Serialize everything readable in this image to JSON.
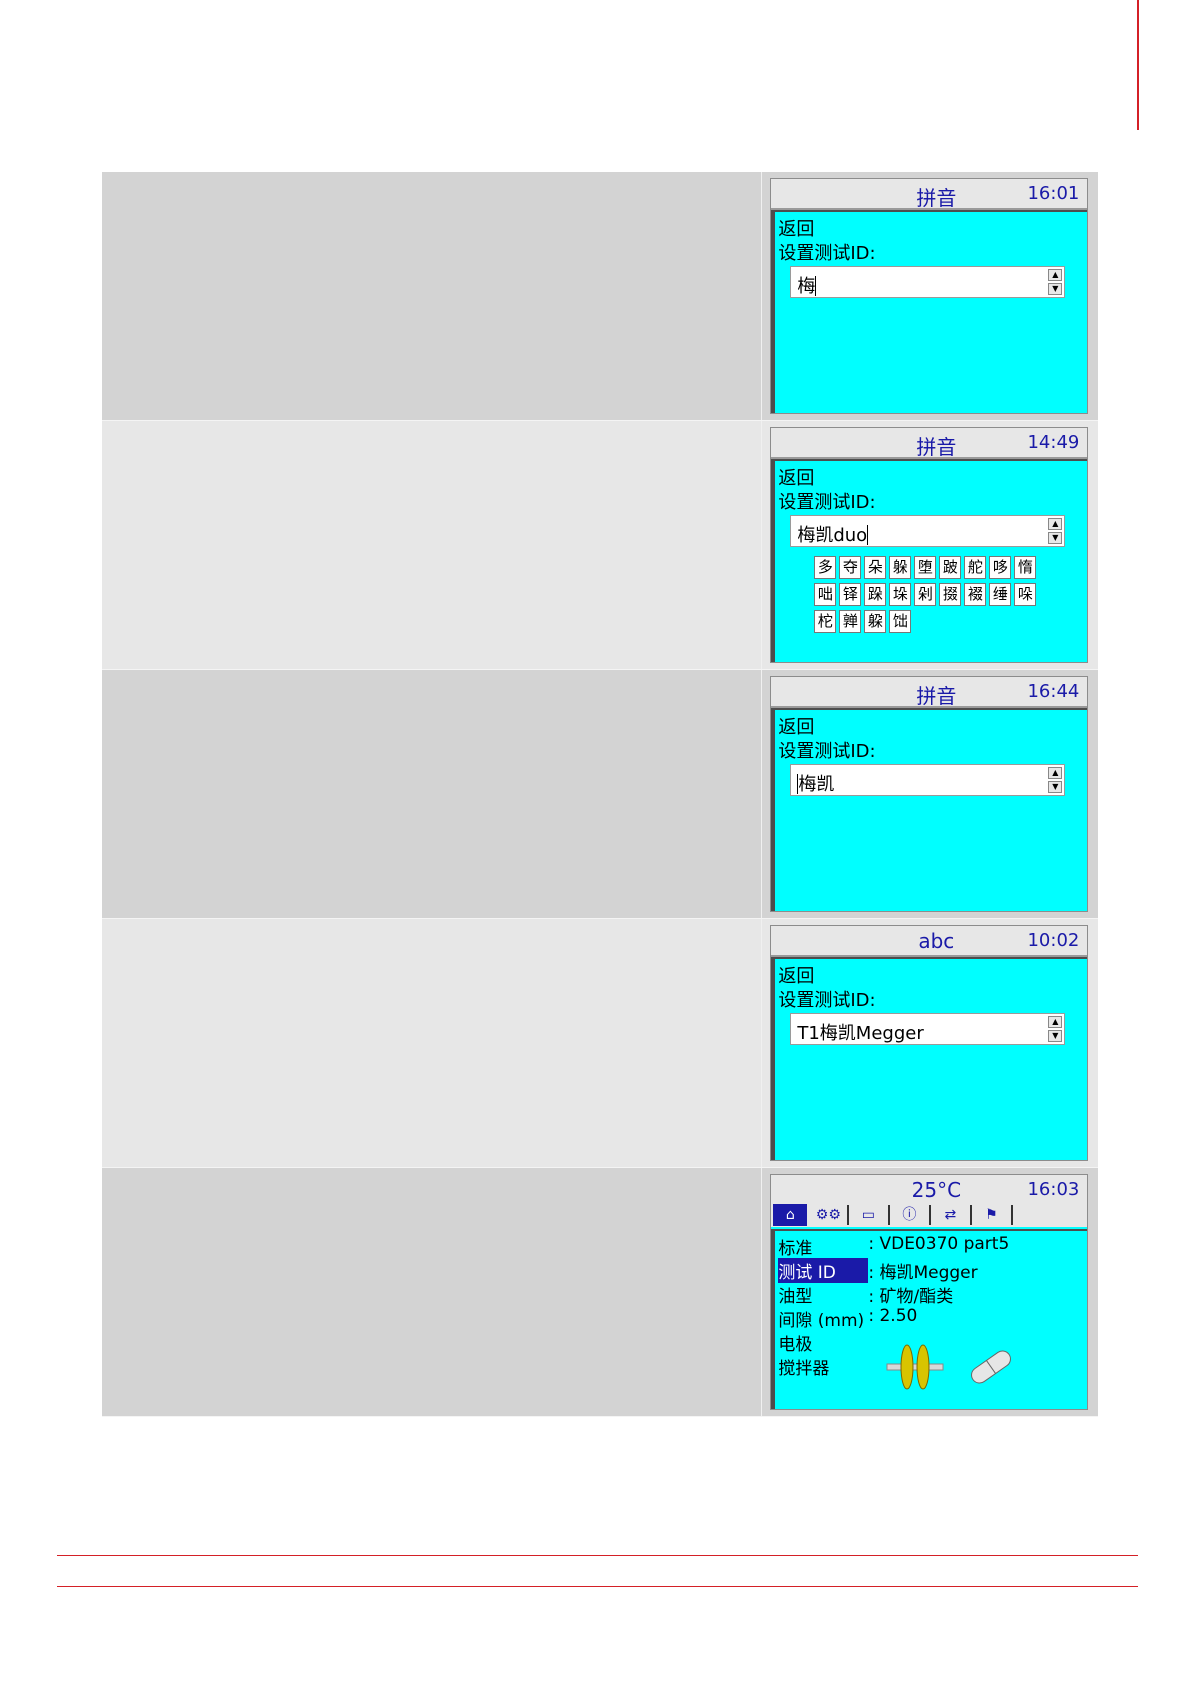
{
  "panels": [
    {
      "header_mode": "拼音",
      "header_time": "16:01",
      "back_label": "返回",
      "set_id_label": "设置测试ID:",
      "input_value": "梅"
    },
    {
      "header_mode": "拼音",
      "header_time": "14:49",
      "back_label": "返回",
      "set_id_label": "设置测试ID:",
      "input_value": "梅凯duo",
      "candidates": [
        "多",
        "夺",
        "朵",
        "躲",
        "堕",
        "跛",
        "舵",
        "哆",
        "惰",
        "咄",
        "铎",
        "跺",
        "垛",
        "剁",
        "掇",
        "裰",
        "缍",
        "哚",
        "柁",
        "亸",
        "躱",
        "饳"
      ]
    },
    {
      "header_mode": "拼音",
      "header_time": "16:44",
      "back_label": "返回",
      "set_id_label": "设置测试ID:",
      "input_value": "梅凯"
    },
    {
      "header_mode": "abc",
      "header_time": "10:02",
      "back_label": "返回",
      "set_id_label": "设置测试ID:",
      "input_value": "T1梅凯Megger"
    }
  ],
  "main_screen": {
    "temperature": "25°C",
    "time": "16:03",
    "tabs": [
      "home-icon",
      "settings-icon",
      "folder-icon",
      "info-icon",
      "transfer-icon",
      "flag-icon"
    ],
    "params": [
      {
        "label": "标准",
        "value": ": VDE0370 part5",
        "selected": false
      },
      {
        "label": "测试 ID",
        "value": ": 梅凯Megger",
        "selected": true
      },
      {
        "label": "油型",
        "value": ": 矿物/酯类",
        "selected": false
      },
      {
        "label": "间隙 (mm)",
        "value": ": 2.50",
        "selected": false
      },
      {
        "label": "电极",
        "value": "",
        "selected": false
      },
      {
        "label": "搅拌器",
        "value": "",
        "selected": false
      }
    ]
  },
  "colors": {
    "screen_bg": "#00ffff",
    "header_text": "#1a1aa8",
    "accent_red": "#d42027"
  }
}
